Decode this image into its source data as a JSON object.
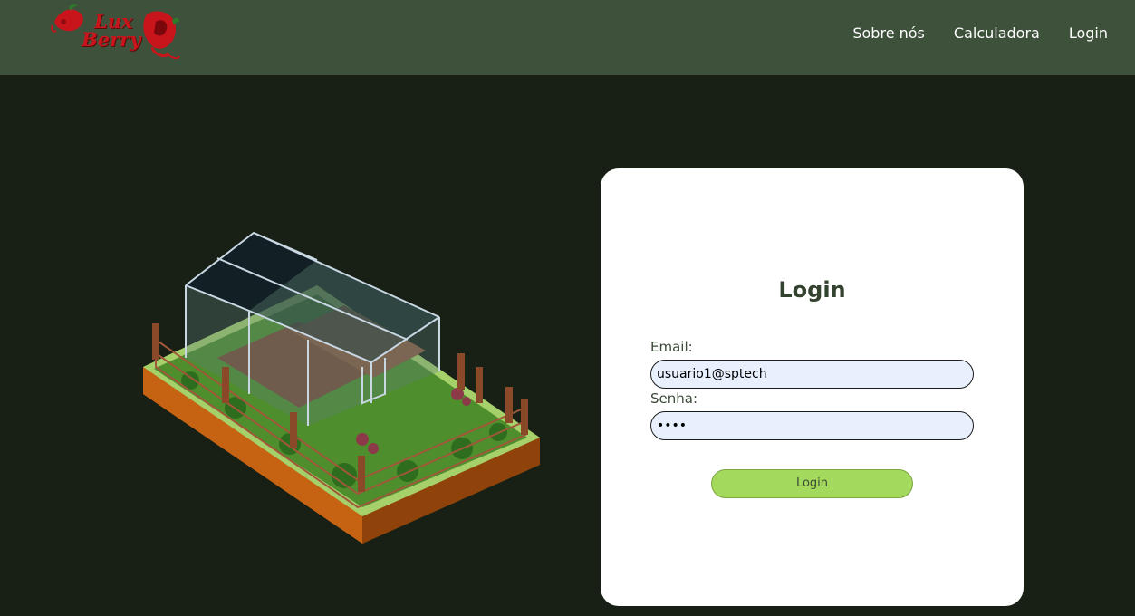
{
  "header": {
    "logo_line1": "Lux",
    "logo_line2": "Berry",
    "nav": [
      {
        "label": "Sobre nós"
      },
      {
        "label": "Calculadora"
      },
      {
        "label": "Login"
      }
    ]
  },
  "login": {
    "title": "Login",
    "email_label": "Email:",
    "email_value": "usuario1@sptech",
    "password_label": "Senha:",
    "password_value": "1234",
    "submit_label": "Login"
  },
  "colors": {
    "header_bg": "#3e513b",
    "page_bg": "#182016",
    "accent_button": "#a3d95c",
    "title_text": "#34432f"
  }
}
